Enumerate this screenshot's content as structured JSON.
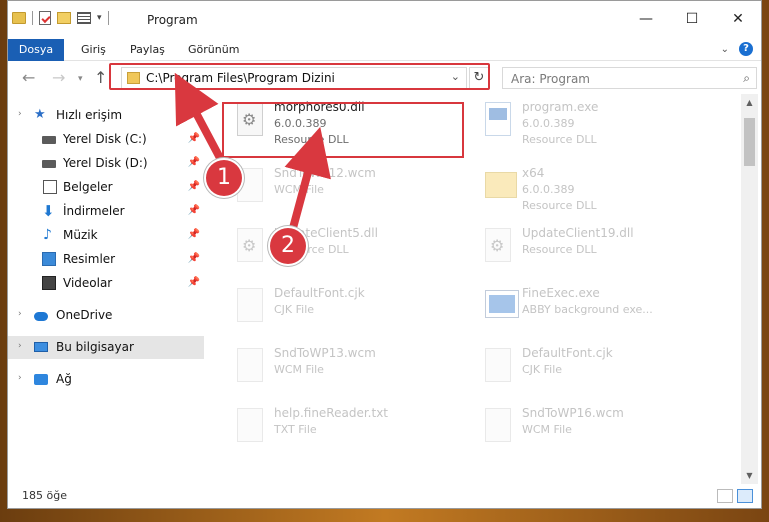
{
  "window": {
    "title": "Program",
    "buttons": {
      "minimize": "—",
      "maximize": "☐",
      "close": "✕"
    }
  },
  "ribbon": {
    "tabs": [
      "Dosya",
      "Giriş",
      "Paylaş",
      "Görünüm"
    ],
    "help": "?"
  },
  "nav": {
    "address": "C:\\Program Files\\Program Dizini",
    "search_placeholder": "Ara: Program"
  },
  "sidebar": {
    "items": [
      {
        "label": "Hızlı erişim",
        "icon": "star-icon"
      },
      {
        "label": "Yerel Disk (C:)",
        "icon": "disk-icon"
      },
      {
        "label": "Yerel Disk (D:)",
        "icon": "disk-icon"
      },
      {
        "label": "Belgeler",
        "icon": "document-icon"
      },
      {
        "label": "İndirmeler",
        "icon": "download-icon"
      },
      {
        "label": "Müzik",
        "icon": "music-icon"
      },
      {
        "label": "Resimler",
        "icon": "pictures-icon"
      },
      {
        "label": "Videolar",
        "icon": "video-icon"
      },
      {
        "label": "OneDrive",
        "icon": "cloud-icon"
      },
      {
        "label": "Bu bilgisayar",
        "icon": "computer-icon"
      },
      {
        "label": "Ağ",
        "icon": "network-icon"
      }
    ]
  },
  "files": [
    {
      "name": "morphores0.dll",
      "meta1": "6.0.0.389",
      "meta2": "Resource DLL",
      "icon": "gear-file-icon"
    },
    {
      "name": "program.exe",
      "meta1": "6.0.0.389",
      "meta2": "Resource DLL",
      "icon": "exe-icon"
    },
    {
      "name": "SndToWP12.wcm",
      "meta1": "WCM File",
      "meta2": "",
      "icon": "file-icon"
    },
    {
      "name": "x64",
      "meta1": "6.0.0.389",
      "meta2": "Resource DLL",
      "icon": "folder-icon"
    },
    {
      "name": "UpdateClient5.dll",
      "meta1": "Resource DLL",
      "meta2": "",
      "icon": "gear-file-icon"
    },
    {
      "name": "UpdateClient19.dll",
      "meta1": "Resource DLL",
      "meta2": "",
      "icon": "gear-file-icon"
    },
    {
      "name": "DefaultFont.cjk",
      "meta1": "CJK File",
      "meta2": "",
      "icon": "file-icon"
    },
    {
      "name": "FineExec.exe",
      "meta1": "ABBY background exe...",
      "meta2": "",
      "icon": "exe-window-icon"
    },
    {
      "name": "SndToWP13.wcm",
      "meta1": "WCM File",
      "meta2": "",
      "icon": "file-icon"
    },
    {
      "name": "DefaultFont.cjk",
      "meta1": "CJK File",
      "meta2": "",
      "icon": "file-icon"
    },
    {
      "name": "help.fineReader.txt",
      "meta1": "TXT File",
      "meta2": "",
      "icon": "file-icon"
    },
    {
      "name": "SndToWP16.wcm",
      "meta1": "WCM File",
      "meta2": "",
      "icon": "file-icon"
    }
  ],
  "status": {
    "item_count": "185 öğe"
  },
  "annotations": {
    "badge1": "1",
    "badge2": "2"
  },
  "colors": {
    "accent": "#1a5fb4",
    "highlight": "#d8373d"
  }
}
